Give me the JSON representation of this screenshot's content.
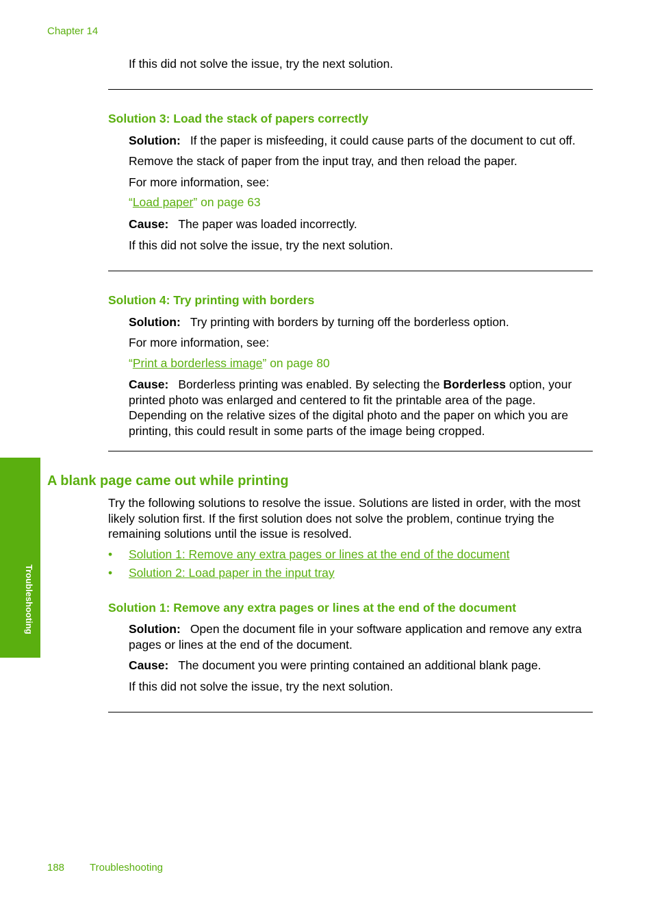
{
  "header": {
    "chapter": "Chapter 14"
  },
  "top": {
    "next_solution": "If this did not solve the issue, try the next solution."
  },
  "solution3": {
    "title": "Solution 3: Load the stack of papers correctly",
    "solution_label": "Solution:",
    "solution_text": "If the paper is misfeeding, it could cause parts of the document to cut off.",
    "step": "Remove the stack of paper from the input tray, and then reload the paper.",
    "more_info": "For more information, see:",
    "link_open_quote": "“",
    "link_text": "Load paper",
    "link_suffix": "” on page 63",
    "cause_label": "Cause:",
    "cause_text": "The paper was loaded incorrectly.",
    "next_solution": "If this did not solve the issue, try the next solution."
  },
  "solution4": {
    "title": "Solution 4: Try printing with borders",
    "solution_label": "Solution:",
    "solution_text": "Try printing with borders by turning off the borderless option.",
    "more_info": "For more information, see:",
    "link_open_quote": "“",
    "link_text": "Print a borderless image",
    "link_suffix": "” on page 80",
    "cause_label": "Cause:",
    "cause_text_before": "Borderless printing was enabled. By selecting the ",
    "cause_bold": "Borderless",
    "cause_text_after": " option, your printed photo was enlarged and centered to fit the printable area of the page. Depending on the relative sizes of the digital photo and the paper on which you are printing, this could result in some parts of the image being cropped."
  },
  "blank_page": {
    "title": "A blank page came out while printing",
    "intro": "Try the following solutions to resolve the issue. Solutions are listed in order, with the most likely solution first. If the first solution does not solve the problem, continue trying the remaining solutions until the issue is resolved.",
    "bullet_char": "•",
    "links": [
      "Solution 1: Remove any extra pages or lines at the end of the document",
      "Solution 2: Load paper in the input tray"
    ],
    "solution1": {
      "title": "Solution 1: Remove any extra pages or lines at the end of the document",
      "solution_label": "Solution:",
      "solution_text": "Open the document file in your software application and remove any extra pages or lines at the end of the document.",
      "cause_label": "Cause:",
      "cause_text": "The document you were printing contained an additional blank page.",
      "next_solution": "If this did not solve the issue, try the next solution."
    }
  },
  "side_tab": {
    "label": "Troubleshooting"
  },
  "footer": {
    "page_number": "188",
    "section": "Troubleshooting"
  },
  "colors": {
    "accent": "#5aaf0f",
    "text": "#000000"
  }
}
